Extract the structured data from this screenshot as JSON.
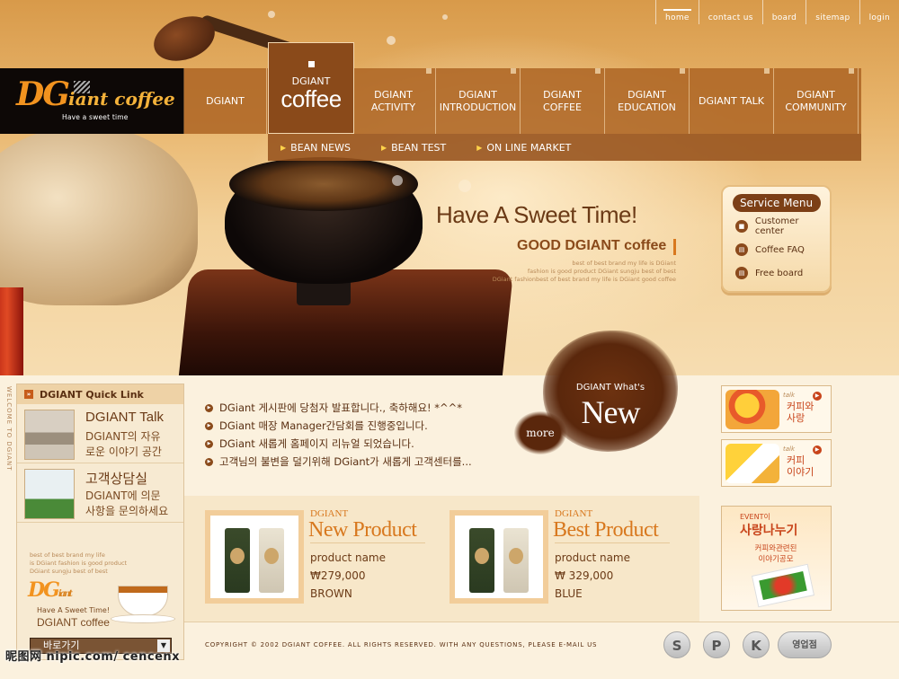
{
  "top_links": [
    "home",
    "contact us",
    "board",
    "sitemap",
    "login"
  ],
  "logo": {
    "dg": "DG",
    "rest": "iant coffee",
    "tagline": "Have a sweet time"
  },
  "nav": {
    "items": [
      {
        "label": "DGIANT"
      },
      {
        "label": ""
      },
      {
        "label": "DGIANT ACTIVITY"
      },
      {
        "label": "DGIANT INTRODUCTION"
      },
      {
        "label": "DGIANT COFFEE"
      },
      {
        "label": "DGIANT EDUCATION"
      },
      {
        "label": "DGIANT TALK"
      },
      {
        "label": "DGIANT COMMUNITY"
      }
    ],
    "active_small": "DGIANT",
    "active_big": "coffee",
    "sub": [
      "BEAN NEWS",
      "BEAN TEST",
      "ON LINE MARKET"
    ]
  },
  "hero": {
    "title": "Have A Sweet Time!",
    "subtitle": "GOOD DGIANT coffee",
    "small_lines": [
      "best of best brand my life is DGiant",
      "fashion is good product DGiant sungju best of best",
      "DGiant fashionbest of best brand my life is DGiant good coffee"
    ]
  },
  "service_menu": {
    "title": "Service Menu",
    "items": [
      "Customer center",
      "Coffee FAQ",
      "Free board"
    ]
  },
  "vertical_text": "WELCOME TO DGIANT",
  "quick_link": {
    "title": "DGIANT Quick Link",
    "items": [
      {
        "title": "DGIANT Talk",
        "line1": "DGIANT의 자유",
        "line2": "로운 이야기 공간"
      },
      {
        "title": "고객상담실",
        "line1": "DGIANT에 의문",
        "line2": "사항을 문의하세요"
      }
    ],
    "small_lines": [
      "best of best brand my life",
      "is DGiant fashion is good product",
      "DGiant sungju best of best"
    ],
    "mini_logo": "DG",
    "mini_logo_small": "iant",
    "sweet": "Have A Sweet Time!",
    "dgc": "DGIANT coffee",
    "select": "바로가기"
  },
  "notices": [
    "DGiant 게시판에 당첨자 발표합니다., 축하해요! *^^*",
    "DGiant 매장 Manager간담회를 진행중입니다.",
    "DGiant 새롭게 홈페이지 리뉴얼 되었습니다.",
    "고객님의 불변을 덜기위해 DGiant가 새롭게 고객센터를..."
  ],
  "whats_new": {
    "small": "DGIANT What's",
    "big": "New",
    "more": "more"
  },
  "talk_banners": [
    {
      "small": "talk",
      "line1": "커피와",
      "line2": "사랑"
    },
    {
      "small": "talk",
      "line1": "커피",
      "line2": "이야기"
    }
  ],
  "products": [
    {
      "brand": "DGIANT",
      "title": "New Product",
      "name": "product name",
      "price": "₩279,000",
      "color": "BROWN"
    },
    {
      "brand": "DGIANT",
      "title": "Best Product",
      "name": "product name",
      "price": "₩ 329,000",
      "color": "BLUE"
    }
  ],
  "event": {
    "small": "EVENT이",
    "title": "사랑나누기",
    "line1": "커피와관련된",
    "line2": "이야기공모"
  },
  "footer": {
    "copyright": "COPYRIGHT © 2002 DGIANT COFFEE. ALL RIGHTS RESERVED. WITH ANY QUESTIONS, PLEASE E-MAIL US",
    "buttons": [
      "S",
      "P",
      "K",
      "영업점"
    ]
  },
  "watermark": "昵图网 nipic.com/ cencenx",
  "colors": {
    "brand_orange": "#f2931f",
    "nav_brown": "#ae6626",
    "dark_brown": "#5a2f12"
  }
}
